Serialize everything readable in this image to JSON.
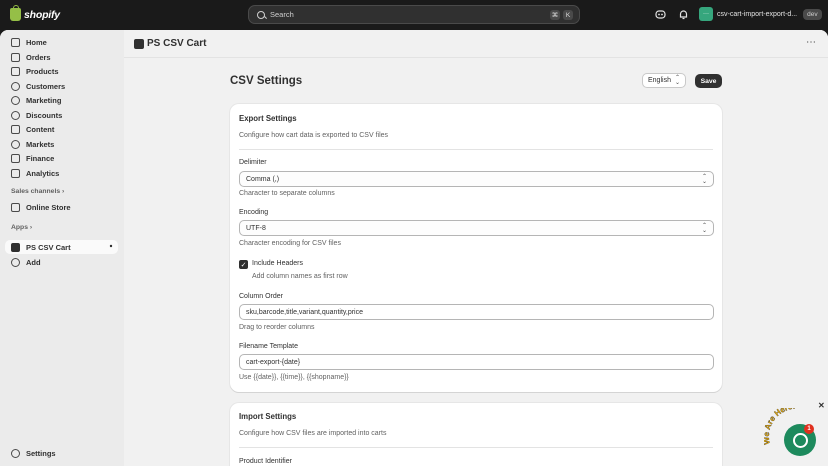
{
  "topbar": {
    "brand": "shopify",
    "search_placeholder": "Search",
    "shortcut_cmd": "⌘",
    "shortcut_key": "K",
    "store_name": "csv-cart-import-export-d...",
    "store_avatar": "···",
    "env_badge": "dev"
  },
  "sidebar": {
    "items": [
      {
        "label": "Home",
        "icon": "home-icon"
      },
      {
        "label": "Orders",
        "icon": "orders-icon"
      },
      {
        "label": "Products",
        "icon": "products-icon"
      },
      {
        "label": "Customers",
        "icon": "customers-icon"
      },
      {
        "label": "Marketing",
        "icon": "marketing-icon"
      },
      {
        "label": "Discounts",
        "icon": "discounts-icon"
      },
      {
        "label": "Content",
        "icon": "content-icon"
      },
      {
        "label": "Markets",
        "icon": "markets-icon"
      },
      {
        "label": "Finance",
        "icon": "finance-icon"
      },
      {
        "label": "Analytics",
        "icon": "analytics-icon"
      }
    ],
    "sales_channels_label": "Sales channels",
    "online_store_label": "Online Store",
    "apps_label": "Apps",
    "app_item_label": "PS CSV Cart",
    "add_label": "Add",
    "settings_label": "Settings"
  },
  "app": {
    "title": "PS CSV Cart"
  },
  "page": {
    "title": "CSV Settings",
    "language": "English",
    "save_label": "Save"
  },
  "export": {
    "title": "Export Settings",
    "description": "Configure how cart data is exported to CSV files",
    "delimiter_label": "Delimiter",
    "delimiter_value": "Comma (,)",
    "delimiter_help": "Character to separate columns",
    "encoding_label": "Encoding",
    "encoding_value": "UTF-8",
    "encoding_help": "Character encoding for CSV files",
    "include_headers_label": "Include Headers",
    "include_headers_checked": true,
    "include_headers_help": "Add column names as first row",
    "column_order_label": "Column Order",
    "column_order_value": "sku,barcode,title,variant,quantity,price",
    "column_order_help": "Drag to reorder columns",
    "filename_label": "Filename Template",
    "filename_value": "cart-export-{date}",
    "filename_help": "Use {{date}}, {{time}}, {{shopname}}"
  },
  "import": {
    "title": "Import Settings",
    "description": "Configure how CSV files are imported into carts",
    "product_identifier_label": "Product Identifier"
  },
  "chat": {
    "badge_count": "1",
    "arc_text": "We Are Here!"
  },
  "colors": {
    "topbar_bg": "#1a1a1a",
    "brand_green": "#95bf47",
    "chat_green": "#1d8a5d",
    "primary_button": "#303030"
  }
}
